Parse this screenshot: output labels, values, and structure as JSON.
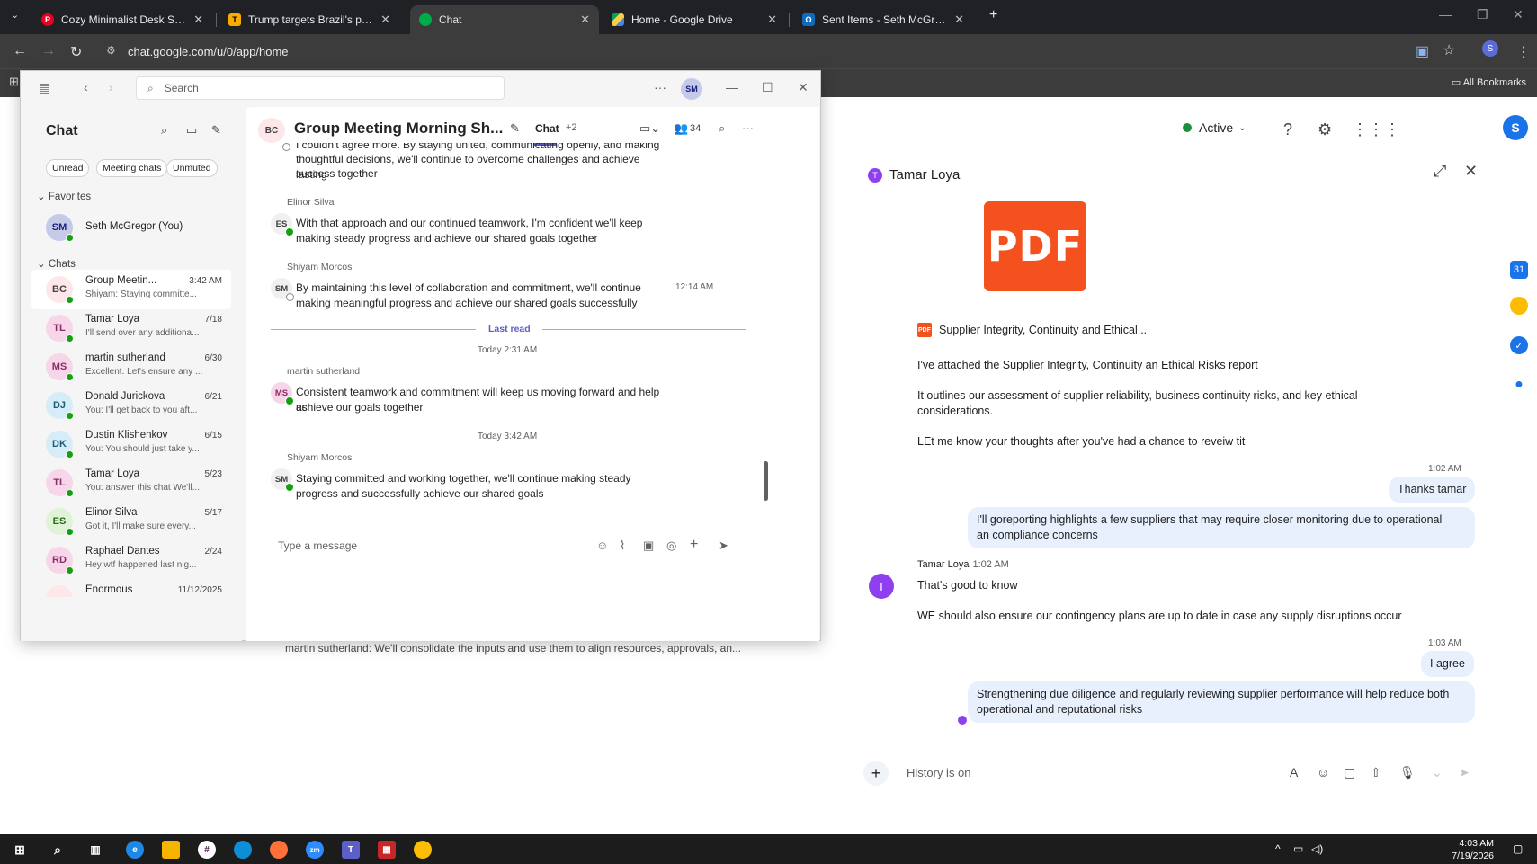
{
  "browser": {
    "tabs": [
      {
        "title": "Cozy Minimalist Desk Setup Ide",
        "favicon_color": "#e60023"
      },
      {
        "title": "Trump targets Brazil's payment",
        "favicon_color": "#f9ab00"
      },
      {
        "title": "Chat",
        "favicon_color": "#00ac47"
      },
      {
        "title": "Home - Google Drive",
        "favicon_color": "#4285f4"
      },
      {
        "title": "Sent Items - Seth McGregor - C",
        "favicon_color": "#0f6cbd"
      }
    ],
    "new_tab": "+",
    "url": "chat.google.com/u/0/app/home",
    "bookmarks_label": "All Bookmarks"
  },
  "gchat": {
    "status": "Active",
    "account_initial": "S",
    "dm_title": "Tamar Loya",
    "dm_avatar_initial": "T",
    "pdf_thumb_text": "PDF",
    "pdf_badge": "PDF",
    "pdf_filename": "Supplier Integrity, Continuity and Ethical...",
    "messages": {
      "m1": "I've attached the Supplier Integrity, Continuity an Ethical Risks report",
      "m2a": "It outlines our assessment of supplier reliability, business continuity risks, and key ethical",
      "m2b": "considerations.",
      "m3": "LEt me know your thoughts after you've had a chance to reveiw tit",
      "t1": "1:02 AM",
      "b1": "Thanks tamar",
      "b2a": "I'll goreporting highlights a few suppliers that may require closer monitoring due to operational",
      "b2b": "an compliance concerns",
      "sender": "Tamar Loya",
      "sender_time": "1:02 AM",
      "m4": "That's good to know",
      "m5": "WE should also ensure our contingency plans are up to date in case any supply disruptions occur",
      "t2": "1:03 AM",
      "b3": "I agree",
      "b4a": "Strengthening due diligence and regularly reviewing supplier performance will help reduce both",
      "b4b": "operational and reputational risks"
    },
    "composer_placeholder": "History is on"
  },
  "teams": {
    "search_placeholder": "Search",
    "user_initials": "SM",
    "sidebar_title": "Chat",
    "filters": [
      "Unread",
      "Meeting chats",
      "Unmuted"
    ],
    "favorites_label": "Favorites",
    "favorite": {
      "initials": "SM",
      "name": "Seth McGregor (You)"
    },
    "chats_label": "Chats",
    "chats": [
      {
        "initials": "BC",
        "name": "Group Meetin...",
        "time": "3:42 AM",
        "preview": "Shiyam: Staying committe...",
        "bg": "#fde7e9",
        "fg": "#424242"
      },
      {
        "initials": "TL",
        "name": "Tamar Loya",
        "time": "7/18",
        "preview": "I'll send over any additiona...",
        "bg": "#f6d6e8",
        "fg": "#8a2d6b"
      },
      {
        "initials": "MS",
        "name": "martin sutherland",
        "time": "6/30",
        "preview": "Excellent. Let's ensure any ...",
        "bg": "#f6d6e8",
        "fg": "#8a2d6b"
      },
      {
        "initials": "DJ",
        "name": "Donald Jurickova",
        "time": "6/21",
        "preview": "You: I'll get back to you aft...",
        "bg": "#d6ecf6",
        "fg": "#1b5e7a"
      },
      {
        "initials": "DK",
        "name": "Dustin Klishenkov",
        "time": "6/15",
        "preview": "You: You should just take y...",
        "bg": "#d6ecf6",
        "fg": "#1b5e7a"
      },
      {
        "initials": "TL",
        "name": "Tamar Loya",
        "time": "5/23",
        "preview": "You: answer this chat We'll...",
        "bg": "#f6d6e8",
        "fg": "#8a2d6b"
      },
      {
        "initials": "ES",
        "name": "Elinor Silva",
        "time": "5/17",
        "preview": "Got it, I'll make sure every...",
        "bg": "#dff3d6",
        "fg": "#2d6a1b"
      },
      {
        "initials": "RD",
        "name": "Raphael Dantes",
        "time": "2/24",
        "preview": "Hey wtf happened last nig...",
        "bg": "#f6d6e8",
        "fg": "#8a2d6b"
      },
      {
        "initials": "",
        "name": "Enormous",
        "time": "11/12/2025",
        "preview": "",
        "bg": "#fde7e9",
        "fg": "#424242"
      }
    ],
    "conv_avatar": "BC",
    "conv_title": "Group Meeting Morning Sh...",
    "tab_chat": "Chat",
    "tab_more": "+2",
    "participants": "34",
    "msgs": {
      "top_a": "I couldn't agree more. By staying united, communicating openly, and making",
      "top_b": "thoughtful decisions, we'll continue to overcome challenges and achieve lasting",
      "top_c": "success together",
      "s1": "Elinor Silva",
      "s1_init": "ES",
      "s1_a": "With that approach and our continued teamwork, I'm confident we'll keep",
      "s1_b": "making steady progress and achieve our shared goals together",
      "s2": "Shiyam Morcos",
      "s2_init": "SM",
      "s2_a": "By maintaining this level of collaboration and commitment, we'll continue",
      "s2_b": "making meaningful progress and achieve our shared goals successfully",
      "s2_time": "12:14 AM",
      "last_read": "Last read",
      "day1": "Today 2:31 AM",
      "s3": "martin sutherland",
      "s3_init": "MS",
      "s3_a": "Consistent teamwork and commitment will keep us moving forward and help us",
      "s3_b": "achieve our goals together",
      "day2": "Today 3:42 AM",
      "s4": "Shiyam Morcos",
      "s4_init": "SM",
      "s4_a": "Staying committed and working together, we'll continue making steady",
      "s4_b": "progress and successfully achieve our shared goals"
    },
    "compose_placeholder": "Type a message",
    "below_window_text": "martin sutherland: We'll consolidate the inputs and use them to align resources, approvals, an..."
  },
  "taskbar": {
    "time": "4:03 AM",
    "date": "7/19/2026"
  }
}
